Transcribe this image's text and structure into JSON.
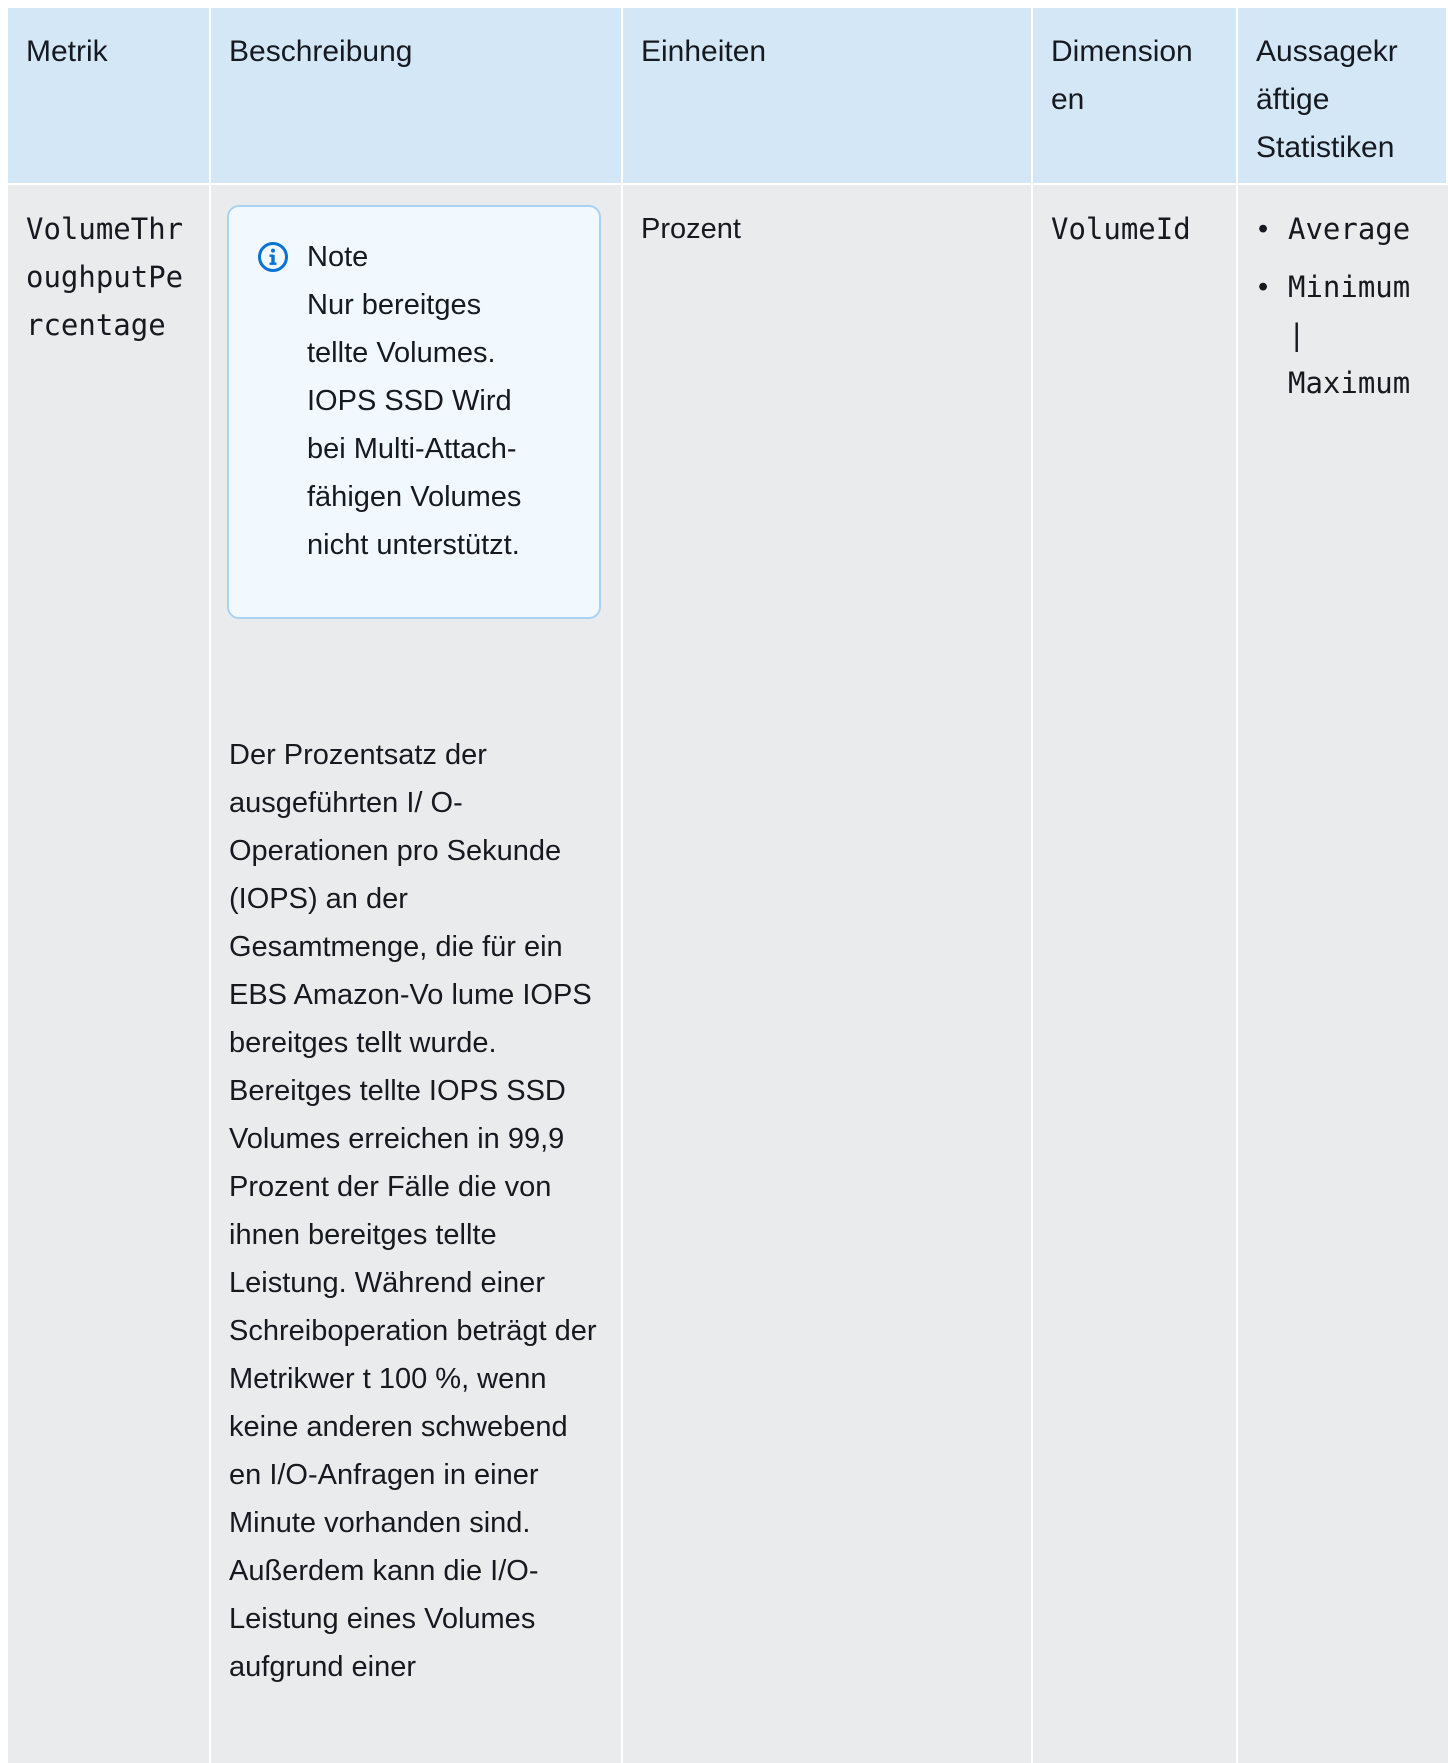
{
  "table": {
    "headers": {
      "metric": "Metrik",
      "description": "Beschreibung",
      "units": "Einheiten",
      "dimensions": "Dimension en",
      "statistics": "Aussagekr äftige Statistiken"
    },
    "row": {
      "metric": "VolumeThroughputPercentage",
      "note_title": "Note",
      "note_text": "Nur bereitges tellte Volumes. IOPS SSD Wird bei Multi-Attach-fähigen Volumes nicht unterstützt.",
      "description": "Der Prozentsatz der ausgeführten I/ O-Operationen pro Sekunde (IOPS) an der Gesamtmenge, die für ein EBS Amazon-Vo lume IOPS bereitges tellt wurde. Bereitges tellte IOPS SSD Volumes erreichen in 99,9 Prozent der Fälle die von ihnen bereitges tellte Leistung. Während einer Schreiboperation beträgt der Metrikwer t 100 %, wenn keine anderen schwebend en I/O-Anfragen in einer Minute vorhanden sind. Außerdem kann die I/O-Leistung eines Volumes aufgrund einer",
      "units": "Prozent",
      "dimension": "VolumeId",
      "statistics": [
        "Average",
        "Minimum | Maximum"
      ]
    }
  },
  "icons": {
    "note": "info-circle-icon"
  },
  "colors": {
    "header_bg": "#d4e7f7",
    "row_bg": "#eaebed",
    "note_border": "#a9d2f3",
    "note_bg": "#f1f8fe",
    "info_icon": "#0972d3"
  }
}
